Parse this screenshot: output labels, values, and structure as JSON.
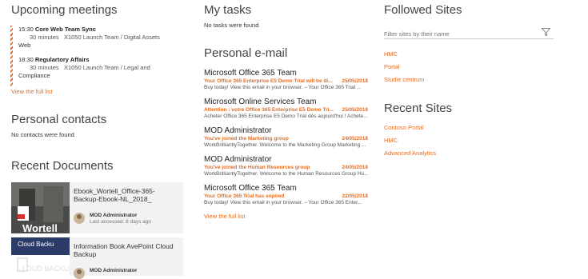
{
  "meetings": {
    "title": "Upcoming meetings",
    "items": [
      {
        "time": "15:30",
        "title": "Core Web Team Sync",
        "duration": "30 minutes",
        "location_a": "X1050 Launch Team / Digital Assets",
        "location_b": "Web"
      },
      {
        "time": "18:30",
        "title": "Regulartory Affairs",
        "duration": "30 minutes",
        "location_a": "X1050 Launch Team / Legal and",
        "location_b": "Compliance"
      }
    ],
    "view_all": "View the full list"
  },
  "contacts": {
    "title": "Personal contacts",
    "empty": "No contacts were found"
  },
  "documents": {
    "title": "Recent Documents",
    "items": [
      {
        "title": "Ebook_Wortell_Office-365-Backup-Ebook-NL_2018_",
        "user": "MOD Administrator",
        "meta": "Last accessed: 8 days ago",
        "thumb_text": "Wortell"
      },
      {
        "title": "Information Book AvePoint Cloud Backup",
        "user": "MOD Administrator",
        "meta": "",
        "thumb_text": "Cloud Backu",
        "thumb_text2": "LOUD BACKU"
      }
    ]
  },
  "tasks": {
    "title": "My tasks",
    "empty": "No tasks were found"
  },
  "email": {
    "title": "Personal e-mail",
    "items": [
      {
        "from": "Microsoft Office 365 Team",
        "subject": "Your Office 365 Enterprise E5 Demo Trial will be di...",
        "date": "25/05/2018",
        "preview": "Buy today! View this email in your browser. –  Your Office 365 Trial ..."
      },
      {
        "from": "Microsoft Online Services Team",
        "subject": "Attention : votre Office 365 Enterprise E5 Demo Tri...",
        "date": "25/05/2018",
        "preview": "Acheter Office 365 Enterprise E5 Demo Trial dès aujourd'hui !  Achete..."
      },
      {
        "from": "MOD Administrator",
        "subject": "You've joined the Marketing group",
        "date": "24/05/2018",
        "preview": "WorkBrilliantlyTogether. Welcome to the Marketing Group Marketing ..."
      },
      {
        "from": "MOD Administrator",
        "subject": "You've joined the Human Resources group",
        "date": "24/05/2018",
        "preview": "WorkBrilliantlyTogether. Welcome to the Human Resources Group Hu..."
      },
      {
        "from": "Microsoft Office 365 Team",
        "subject": "Your Office 365 Trial has expired",
        "date": "22/05/2018",
        "preview": "Buy today! View this email in your browser.  –  Your Office 365 Enter..."
      }
    ],
    "view_all": "View the full list"
  },
  "followed": {
    "title": "Followed Sites",
    "filter_placeholder": "Filter sites by their name",
    "items": [
      "HMC",
      "Portal",
      "Studie centrum"
    ]
  },
  "recent_sites": {
    "title": "Recent Sites",
    "items": [
      "Contoso Portal",
      "HMC",
      "Advanced Analytics"
    ]
  },
  "colors": {
    "accent": "#e86b1f"
  },
  "icons": {
    "filter": "filter-icon",
    "avatar": "user-avatar"
  }
}
